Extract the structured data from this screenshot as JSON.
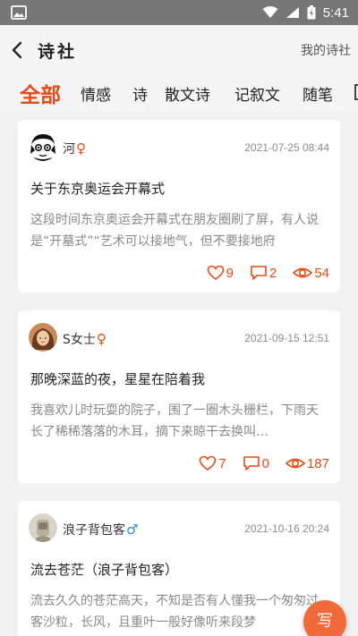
{
  "status_bar": {
    "time": "5:41"
  },
  "header": {
    "title": "诗社",
    "right_link": "我的诗社"
  },
  "tabs": [
    {
      "label": "全部",
      "active": true
    },
    {
      "label": "情感",
      "active": false
    },
    {
      "label": "诗",
      "active": false
    },
    {
      "label": "散文诗",
      "active": false
    },
    {
      "label": "记叙文",
      "active": false
    },
    {
      "label": "随笔",
      "active": false
    }
  ],
  "posts": [
    {
      "author": "河",
      "gender": "♀",
      "date": "2021-07-25 08:44",
      "title": "关于东京奥运会开幕式",
      "excerpt": "这段时间东京奥运会开幕式在朋友圈刷了屏，有人说是“开墓式”“艺术可以接地气，但不要接地府",
      "likes": "9",
      "comments": "2",
      "views": "54"
    },
    {
      "author": "S女士",
      "gender": "♀",
      "date": "2021-09-15 12:51",
      "title": "那晚深蓝的夜，星星在陪着我",
      "excerpt": "我喜欢儿时玩耍的院子，围了一圈木头栅栏，下雨天长了稀稀落落的木耳，摘下来晾干去换叫…",
      "likes": "7",
      "comments": "0",
      "views": "187"
    },
    {
      "author": "浪子背包客",
      "gender": "♂",
      "date": "2021-10-16 20:24",
      "title": "流去苍茫（浪子背包客）",
      "excerpt": "流去久久的苍茫高天，不知是否有人懂我一个匆匆过客沙粒，长风，且重叶一般好像听来段梦"
    }
  ],
  "fab": {
    "label": "写"
  },
  "colors": {
    "accent": "#e84a16",
    "status_bar": "#767676",
    "male": "#2b8fe0"
  }
}
